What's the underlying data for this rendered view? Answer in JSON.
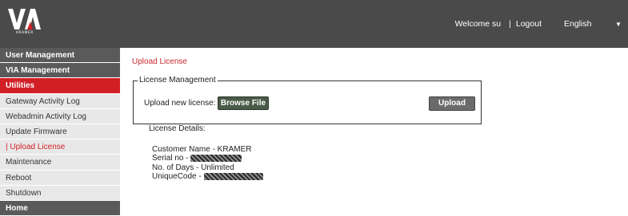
{
  "header": {
    "logo_text": "KRAMER",
    "welcome_text": "Welcome su",
    "separator": "|",
    "logout_label": "Logout",
    "language_selected": "English",
    "colors": {
      "topbar": "#4a4a4a",
      "accent_red": "#d21f26"
    }
  },
  "sidebar": {
    "items": [
      {
        "label": "User Management"
      },
      {
        "label": "VIA Management"
      },
      {
        "label": "Utilities"
      },
      {
        "label": "Gateway Activity Log"
      },
      {
        "label": "Webadmin Activity Log"
      },
      {
        "label": "Update Firmware"
      },
      {
        "label": "| Upload License"
      },
      {
        "label": "Maintenance"
      },
      {
        "label": "Reboot"
      },
      {
        "label": "Shutdown"
      },
      {
        "label": "Home"
      }
    ]
  },
  "main": {
    "page_title": "Upload License",
    "license_management": {
      "legend": "License Management",
      "upload_label": "Upload new license:",
      "browse_label": "Browse File",
      "upload_button_label": "Upload"
    },
    "license_details": {
      "title": "License Details:",
      "customer_name": "Customer Name - KRAMER",
      "serial_prefix": "Serial no -",
      "days": "No. of Days - Unlimited",
      "unique_prefix": "UniqueCode -"
    }
  }
}
